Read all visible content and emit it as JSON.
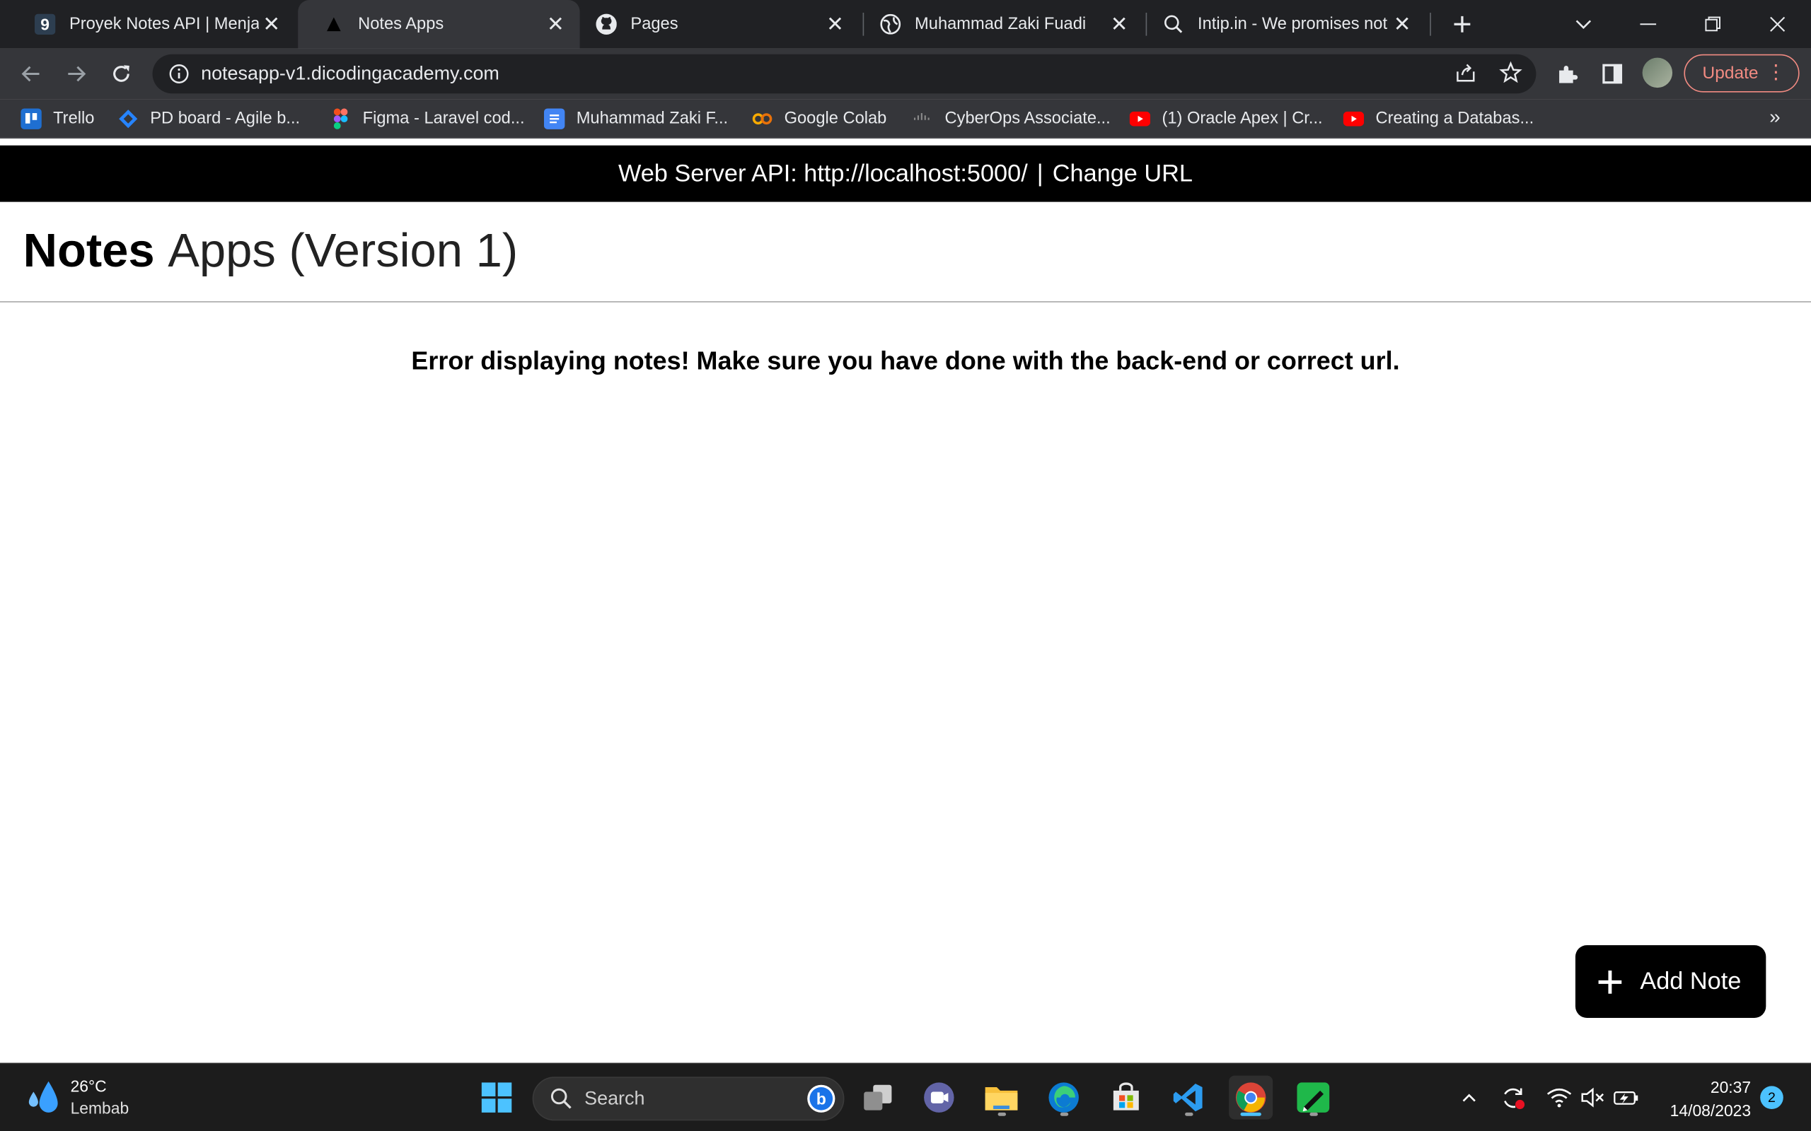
{
  "browser": {
    "tabs": [
      {
        "title": "Proyek Notes API | Menjadi",
        "icon": "dicoding-icon",
        "active": false
      },
      {
        "title": "Notes Apps",
        "icon": "triangle-icon",
        "active": true
      },
      {
        "title": "Pages",
        "icon": "github-icon",
        "active": false
      },
      {
        "title": "Muhammad Zaki Fuadi",
        "icon": "globe-icon",
        "active": false
      },
      {
        "title": "Intip.in - We promises not",
        "icon": "magnifier-icon",
        "active": false
      }
    ],
    "address": "notesapp-v1.dicodingacademy.com",
    "update_label": "Update",
    "bookmarks": [
      {
        "label": "Trello",
        "icon": "trello-icon",
        "color": "#1f6fd1"
      },
      {
        "label": "PD board - Agile b...",
        "icon": "jira-icon",
        "color": "#2684ff"
      },
      {
        "label": "Figma - Laravel cod...",
        "icon": "figma-icon",
        "color": "#f24e1e"
      },
      {
        "label": "Muhammad Zaki F...",
        "icon": "docs-icon",
        "color": "#4285f4"
      },
      {
        "label": "Google Colab",
        "icon": "colab-icon",
        "color": "#f9ab00"
      },
      {
        "label": "CyberOps Associate...",
        "icon": "cisco-icon",
        "color": "#8a8a8a"
      },
      {
        "label": "(1) Oracle Apex | Cr...",
        "icon": "youtube-icon",
        "color": "#ff0000"
      },
      {
        "label": "Creating a Databas...",
        "icon": "youtube-icon",
        "color": "#ff0000"
      }
    ]
  },
  "page": {
    "api_label": "Web Server API: http://localhost:5000/",
    "api_separator": "|",
    "change_url": "Change URL",
    "title_bold": "Notes",
    "title_light": "Apps (Version 1)",
    "error": "Error displaying notes! Make sure you have done with the back-end or correct url.",
    "add_note": "Add Note"
  },
  "taskbar": {
    "temperature": "26°C",
    "condition": "Lembab",
    "search_placeholder": "Search",
    "time": "20:37",
    "date": "14/08/2023",
    "notification_count": "2"
  },
  "colors": {
    "accent": "#000000",
    "update": "#f28b82",
    "taskbar_accent": "#4cc2ff"
  }
}
